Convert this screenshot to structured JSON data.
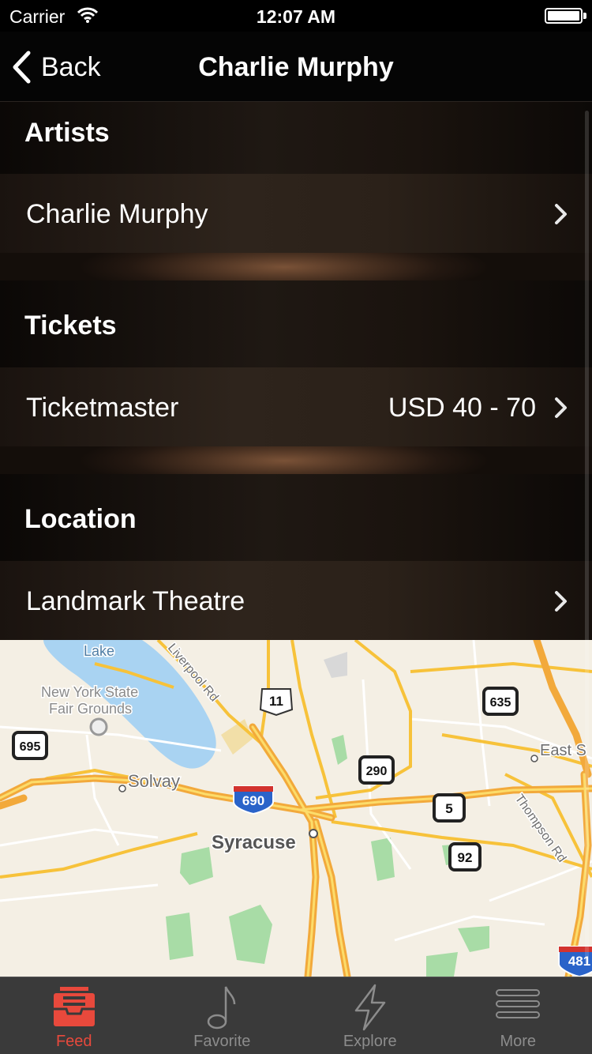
{
  "status_bar": {
    "carrier": "Carrier",
    "time": "12:07 AM"
  },
  "nav": {
    "back_label": "Back",
    "title": "Charlie Murphy"
  },
  "sections": {
    "artists": {
      "title": "Artists",
      "row_label": "Charlie Murphy"
    },
    "tickets": {
      "title": "Tickets",
      "row_label": "Ticketmaster",
      "row_value": "USD 40 - 70"
    },
    "location": {
      "title": "Location",
      "row_label": "Landmark Theatre"
    }
  },
  "map": {
    "labels": {
      "lake": "Lake",
      "liverpool": "Liverpool Rd",
      "fairgrounds1": "New York State",
      "fairgrounds2": "Fair Grounds",
      "solvay": "Solvay",
      "syracuse": "Syracuse",
      "east": "East S",
      "thompson": "Thompson Rd"
    },
    "shields": {
      "us11": "11",
      "r635": "635",
      "r695": "695",
      "i690": "690",
      "r290": "290",
      "r5": "5",
      "r92": "92",
      "i481": "481"
    }
  },
  "tabs": [
    {
      "label": "Feed",
      "icon": "inbox-tray-icon",
      "active": true
    },
    {
      "label": "Favorite",
      "icon": "music-note-icon",
      "active": false
    },
    {
      "label": "Explore",
      "icon": "lightning-icon",
      "active": false
    },
    {
      "label": "More",
      "icon": "menu-lines-icon",
      "active": false
    }
  ],
  "colors": {
    "accent": "#e8493c",
    "inactive_tab": "#8c8c8c",
    "highway": "#f7c23a",
    "water": "#a9d3f2",
    "park": "#9fd8a0"
  }
}
